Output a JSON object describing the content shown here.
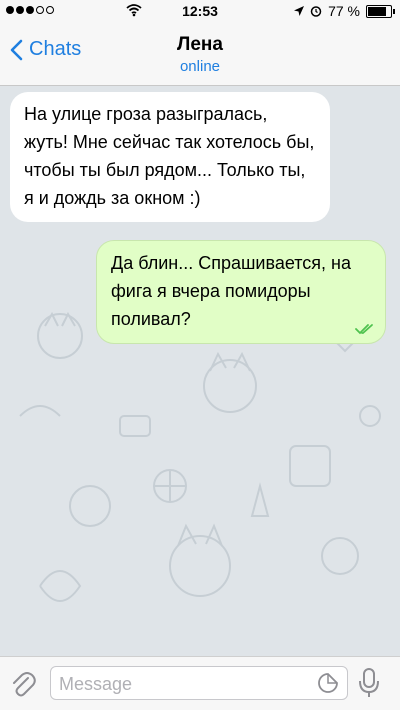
{
  "status": {
    "time": "12:53",
    "battery": "77 %"
  },
  "nav": {
    "back_label": "Chats",
    "title": "Лена",
    "subtitle": "online"
  },
  "messages": [
    {
      "direction": "incoming",
      "text": "На улице гроза разыгралась, жуть! Мне сейчас так хотелось бы, чтобы ты был рядом... Только ты, я и дождь за окном :)"
    },
    {
      "direction": "outgoing",
      "text": "Да блин... Спрашивается, на фига я вчера помидоры поливал?",
      "status": "read"
    }
  ],
  "input": {
    "placeholder": "Message"
  },
  "colors": {
    "accent": "#1f7fe0",
    "outgoing_bubble": "#e1fec6",
    "incoming_bubble": "#ffffff",
    "read_ticks": "#4fc24f"
  },
  "icons": [
    "signal-icon",
    "wifi-icon",
    "location-icon",
    "alarm-icon",
    "battery-icon",
    "chevron-left-icon",
    "double-check-icon",
    "paperclip-icon",
    "sticker-icon",
    "microphone-icon"
  ]
}
